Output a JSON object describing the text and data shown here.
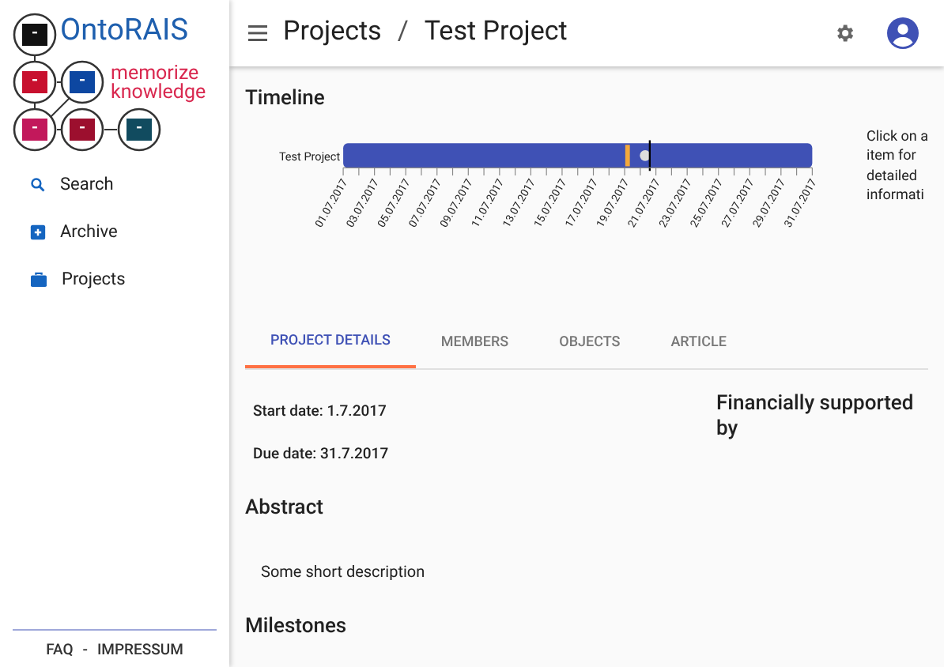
{
  "logo": {
    "name": "OntoRAIS",
    "tagline_lines": [
      "memorize",
      "knowledge"
    ]
  },
  "sidebar": {
    "items": [
      {
        "kind": "search",
        "label": "Search"
      },
      {
        "kind": "archive",
        "label": "Archive"
      },
      {
        "kind": "projects",
        "label": "Projects"
      }
    ],
    "footer": [
      "FAQ",
      "-",
      "IMPRESSUM"
    ]
  },
  "header": {
    "breadcrumb": [
      "Projects",
      "/",
      "Test Project"
    ]
  },
  "timeline": {
    "title": "Timeline",
    "row_label": "Test Project",
    "axis_labels": [
      "01.07.2017",
      "03.07.2017",
      "05.07.2017",
      "07.07.2017",
      "09.07.2017",
      "11.07.2017",
      "13.07.2017",
      "15.07.2017",
      "17.07.2017",
      "19.07.2017",
      "21.07.2017",
      "23.07.2017",
      "25.07.2017",
      "27.07.2017",
      "29.07.2017",
      "31.07.2017"
    ],
    "hint": "Click on a\nitem for\ndetailed\ninformati"
  },
  "tabs": [
    {
      "label": "PROJECT DETAILS",
      "selected": true
    },
    {
      "label": "MEMBERS",
      "selected": false
    },
    {
      "label": "OBJECTS",
      "selected": false
    },
    {
      "label": "ARTICLE",
      "selected": false
    }
  ],
  "details": {
    "start": "Start date: 1.7.2017",
    "due": "Due date: 31.7.2017",
    "funding_title": "Financially supported by"
  },
  "sections": [
    {
      "title": "Abstract",
      "text": "Some short description"
    },
    {
      "title": "Milestones"
    }
  ]
}
